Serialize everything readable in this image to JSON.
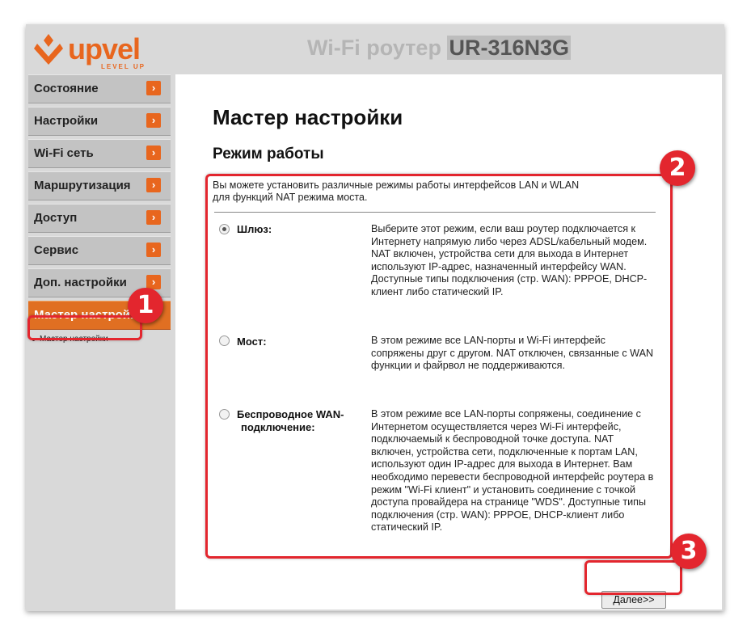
{
  "header": {
    "logo_text": "upvel",
    "logo_tagline": "LEVEL UP",
    "router_title": "Wi-Fi роутер",
    "router_model": "UR-316N3G"
  },
  "sidebar": {
    "items": [
      {
        "label": "Состояние"
      },
      {
        "label": "Настройки"
      },
      {
        "label": "Wi-Fi сеть"
      },
      {
        "label": "Маршрутизация"
      },
      {
        "label": "Доступ"
      },
      {
        "label": "Сервис"
      },
      {
        "label": "Доп. настройки"
      },
      {
        "label": "Мастер настройки"
      }
    ],
    "sub_items": [
      {
        "label": "Мастер настройки"
      }
    ]
  },
  "main": {
    "page_title": "Мастер настройки",
    "section_title": "Режим работы",
    "description_line1": "Вы можете установить различные режимы работы интерфейсов LAN и WLAN",
    "description_line2": "для функций NAT режима моста.",
    "modes": [
      {
        "label_line1": "Шлюз:",
        "label_line2": "",
        "checked": true,
        "description": "Выберите этот режим, если ваш роутер подключается к Интернету напрямую либо через ADSL/кабельный модем. NAT включен, устройства сети для выхода в Интернет используют IP-адрес, назначенный интерфейсу WAN. Доступные типы подключения (стр. WAN): PPPOE, DHCP-клиент либо статический IP."
      },
      {
        "label_line1": "Мост:",
        "label_line2": "",
        "checked": false,
        "description": "В этом режиме все LAN-порты и Wi-Fi интерфейс сопряжены друг с другом. NAT отключен, связанные с WAN функции и файрвол не поддерживаются."
      },
      {
        "label_line1": "Беспроводное WAN-",
        "label_line2": "подключение:",
        "checked": false,
        "description": "В этом режиме все LAN-порты сопряжены, соединение с Интернетом осуществляется через Wi-Fi интерфейс, подключаемый к беспроводной точке доступа. NAT включен, устройства сети, подключенные к портам LAN, используют один IP-адрес для выхода в Интернет. Вам необходимо перевести беспроводной интерфейс роутера в режим \"Wi-Fi клиент\" и установить соединение с точкой доступа провайдера на странице \"WDS\". Доступные типы подключения (стр. WAN): PPPOE, DHCP-клиент либо статический IP."
      }
    ],
    "next_button": "Далее>>"
  },
  "annotations": {
    "step1": "1",
    "step2": "2",
    "step3": "3",
    "color": "#e3262e"
  },
  "colors": {
    "brand_orange": "#e8661e",
    "nav_bg": "#c3c3c3",
    "frame_bg": "#d9d9d9"
  }
}
